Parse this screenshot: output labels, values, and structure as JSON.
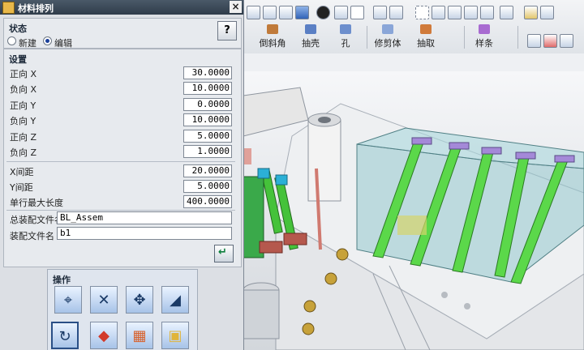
{
  "dialog": {
    "title": "材料排列",
    "close": "×",
    "status": {
      "label": "状态",
      "options": [
        "新建",
        "编辑"
      ],
      "selected": "编辑",
      "help": "?"
    },
    "settings": {
      "label": "设置",
      "rows": [
        {
          "label": "正向 X",
          "value": "30.0000"
        },
        {
          "label": "负向 X",
          "value": "10.0000"
        },
        {
          "label": "正向 Y",
          "value": "0.0000"
        },
        {
          "label": "负向 Y",
          "value": "10.0000"
        },
        {
          "label": "正向 Z",
          "value": "5.0000"
        },
        {
          "label": "负向 Z",
          "value": "1.0000"
        }
      ],
      "spacing": [
        {
          "label": "X间距",
          "value": "20.0000"
        },
        {
          "label": "Y间距",
          "value": "5.0000"
        },
        {
          "label": "单行最大长度",
          "value": "400.0000"
        }
      ],
      "total_assembly": {
        "label": "总装配文件名",
        "value": "BL_Assem"
      },
      "assembly_file": {
        "label": "装配文件名",
        "value": "b1"
      },
      "apply_icon": "apply-arrow-icon"
    },
    "operations": {
      "label": "操作",
      "buttons": [
        "point-move-icon",
        "delete-cross-icon",
        "move-arrows-icon",
        "wedge-icon",
        "rotate-icon",
        "box-red-icon",
        "box-stack-icon",
        "box-yellow-icon"
      ]
    }
  },
  "toolbar": {
    "groups": [
      {
        "label": "倒斜角"
      },
      {
        "label": "抽壳"
      },
      {
        "label": "孔"
      },
      {
        "label": "修剪体"
      },
      {
        "label": "抽取"
      },
      {
        "label": "样条"
      }
    ]
  }
}
